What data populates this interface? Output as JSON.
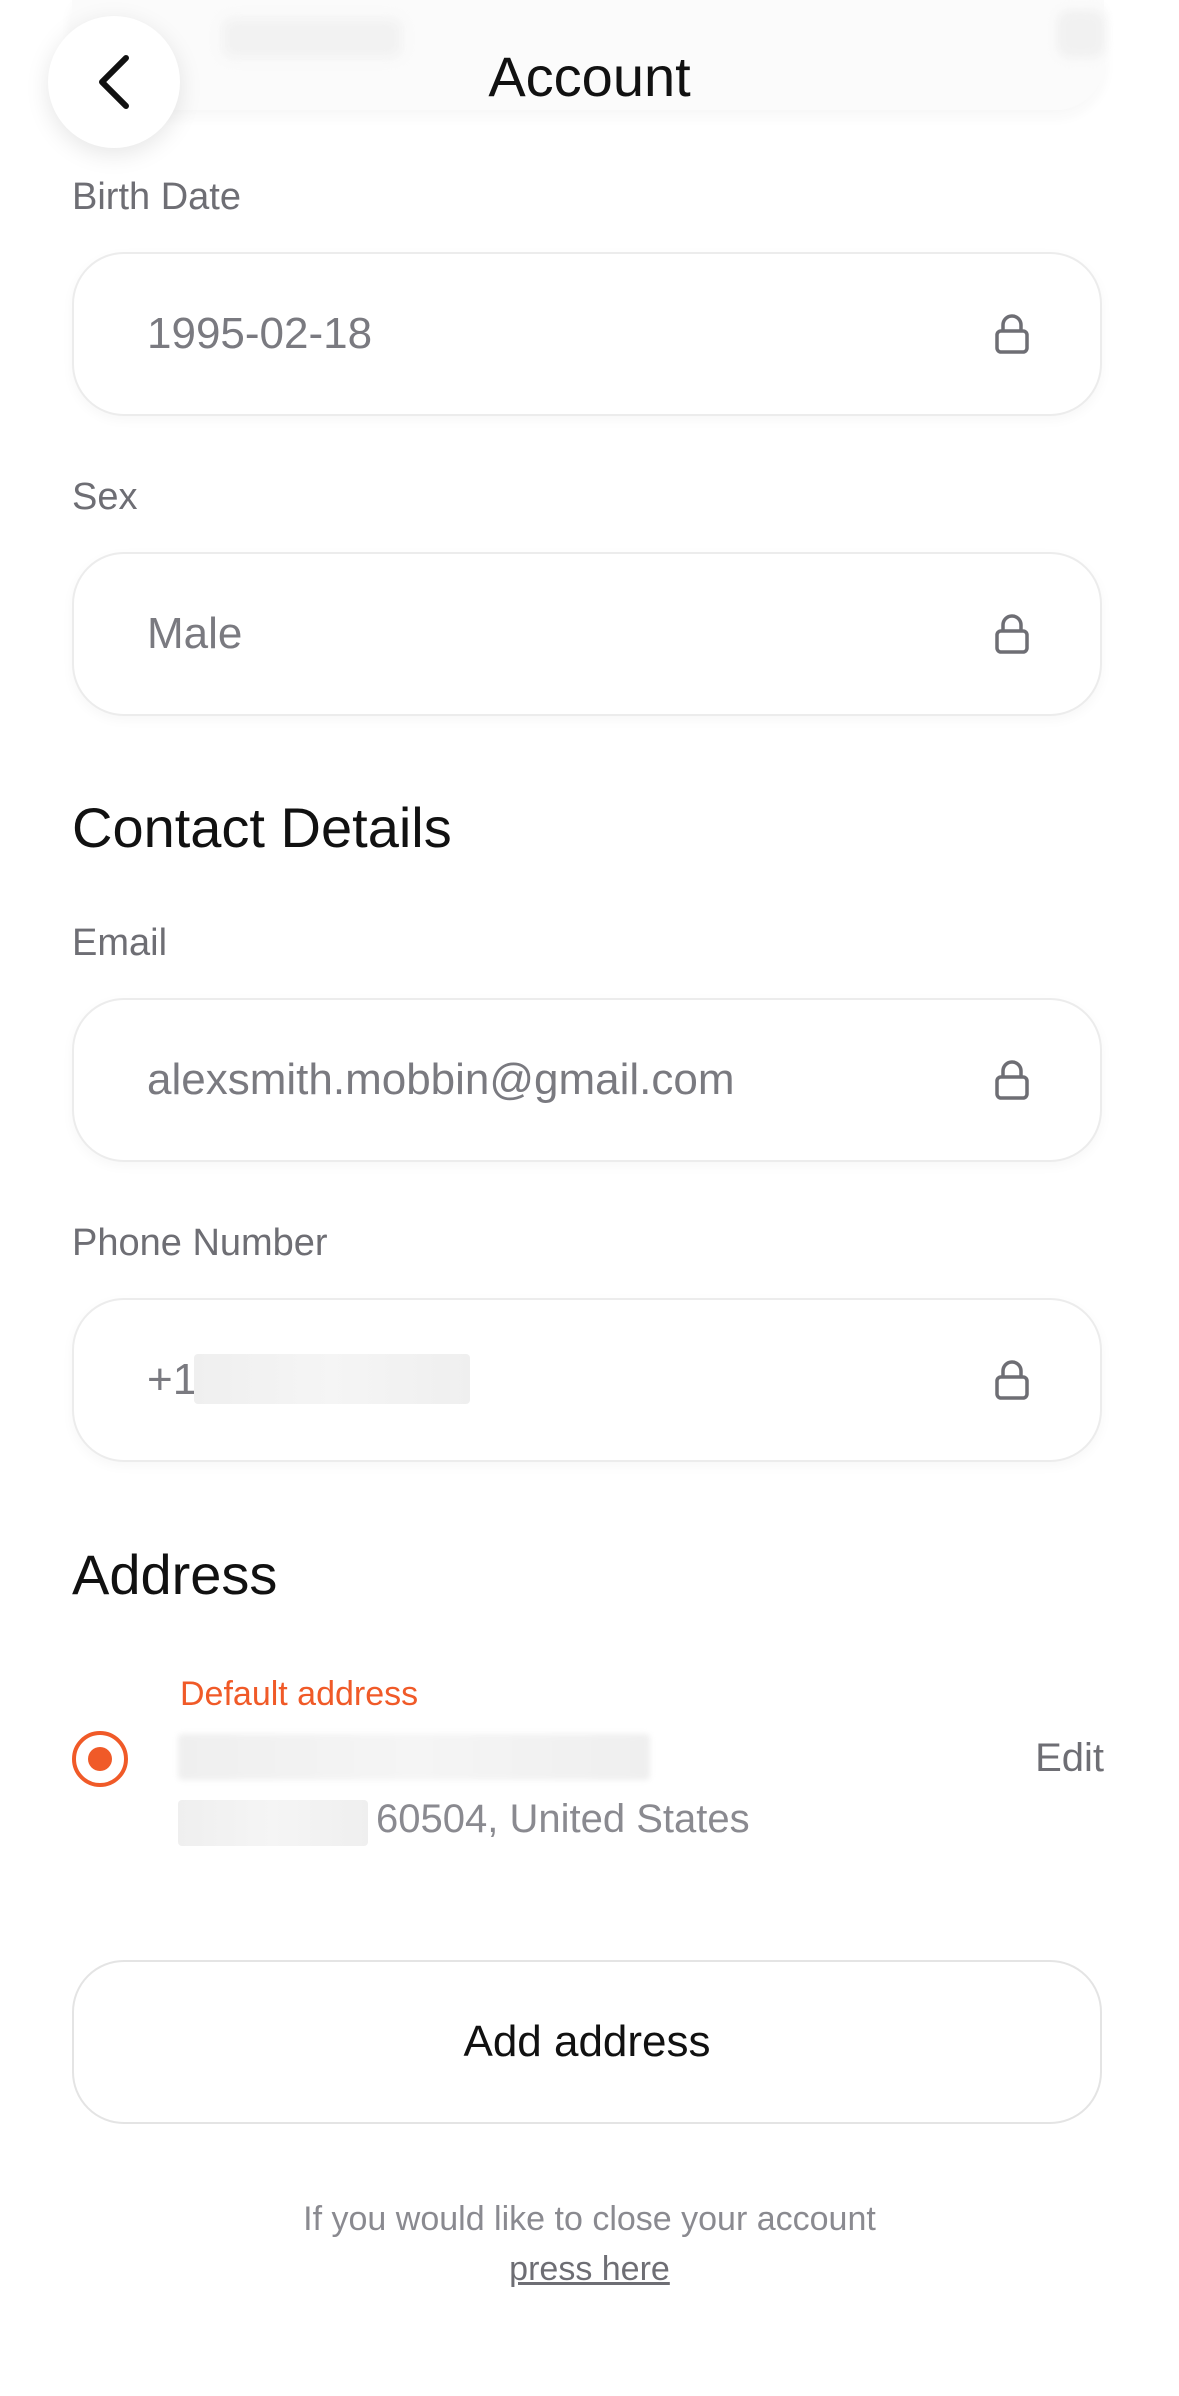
{
  "header": {
    "title": "Account"
  },
  "fields": {
    "birth_date": {
      "label": "Birth Date",
      "value": "1995-02-18"
    },
    "sex": {
      "label": "Sex",
      "value": "Male"
    },
    "email": {
      "label": "Email",
      "value": "alexsmith.mobbin@gmail.com"
    },
    "phone": {
      "label": "Phone Number",
      "value": "+1"
    }
  },
  "sections": {
    "contact_details": "Contact Details",
    "address": "Address"
  },
  "address": {
    "default_label": "Default address",
    "line2": "60504, United States",
    "edit_label": "Edit",
    "selected": true
  },
  "actions": {
    "add_address": "Add address"
  },
  "footer": {
    "close_note": "If you would like to close your account",
    "close_link": "press here"
  },
  "colors": {
    "accent": "#f05a28",
    "text_primary": "#111111",
    "text_secondary": "#6e6e74",
    "field_text": "#7a7a80"
  }
}
